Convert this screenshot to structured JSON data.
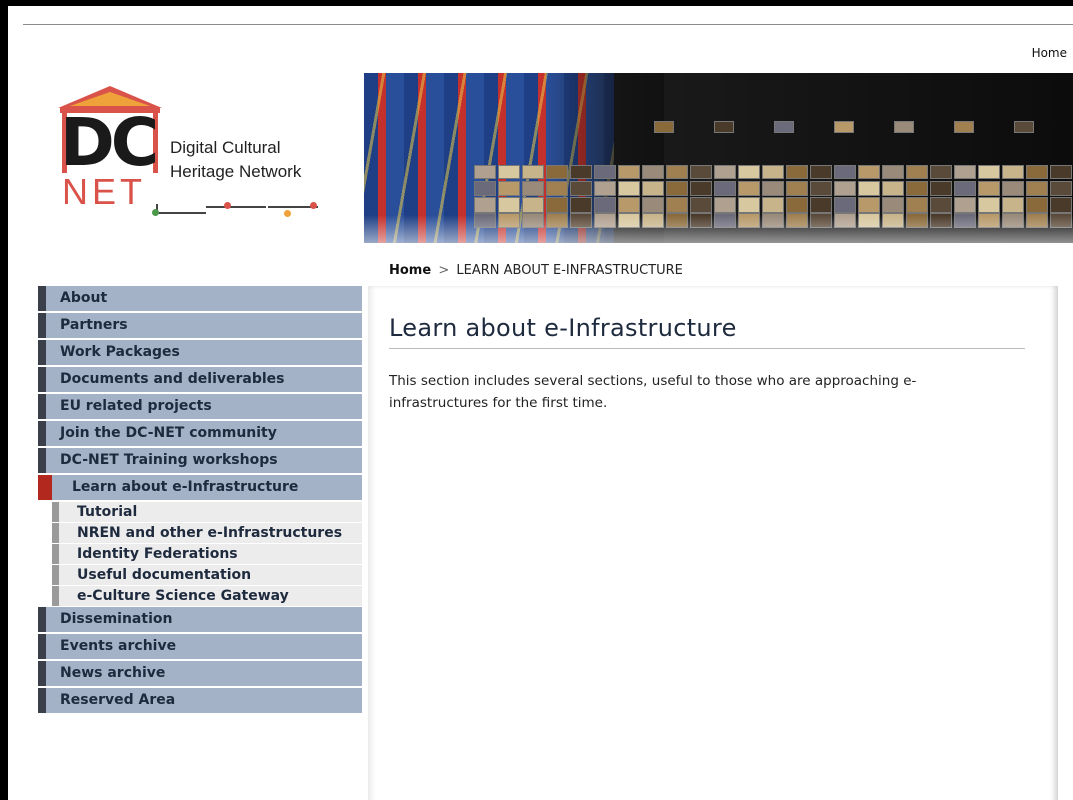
{
  "topnav": {
    "home_label": "Home"
  },
  "logo": {
    "dc": "DC",
    "net": "NET",
    "line1": "Digital Cultural",
    "line2": "Heritage Network"
  },
  "breadcrumb": {
    "home": "Home",
    "separator": ">",
    "current": "LEARN ABOUT E-INFRASTRUCTURE"
  },
  "sidebar": {
    "items_top": [
      {
        "label": "About"
      },
      {
        "label": "Partners"
      },
      {
        "label": "Work Packages"
      },
      {
        "label": "Documents and deliverables"
      },
      {
        "label": "EU related projects"
      },
      {
        "label": "Join the DC-NET community"
      },
      {
        "label": "DC-NET Training workshops"
      }
    ],
    "active": {
      "label": "Learn about e-Infrastructure"
    },
    "subitems": [
      {
        "label": "Tutorial"
      },
      {
        "label": "NREN and other e-Infrastructures"
      },
      {
        "label": "Identity Federations"
      },
      {
        "label": "Useful documentation"
      },
      {
        "label": "e-Culture Science Gateway"
      }
    ],
    "items_bottom": [
      {
        "label": "Dissemination"
      },
      {
        "label": "Events archive"
      },
      {
        "label": "News archive"
      },
      {
        "label": "Reserved Area"
      }
    ]
  },
  "main": {
    "title": "Learn about e-Infrastructure",
    "body": "This section includes several sections, useful to those who are approaching e-infrastructures for the first time."
  },
  "colors": {
    "nav_bg": "#a3b2c6",
    "nav_marker": "#3a3f4a",
    "active_marker": "#b2271e",
    "logo_red": "#d9534a",
    "logo_orange": "#f0a23a"
  }
}
